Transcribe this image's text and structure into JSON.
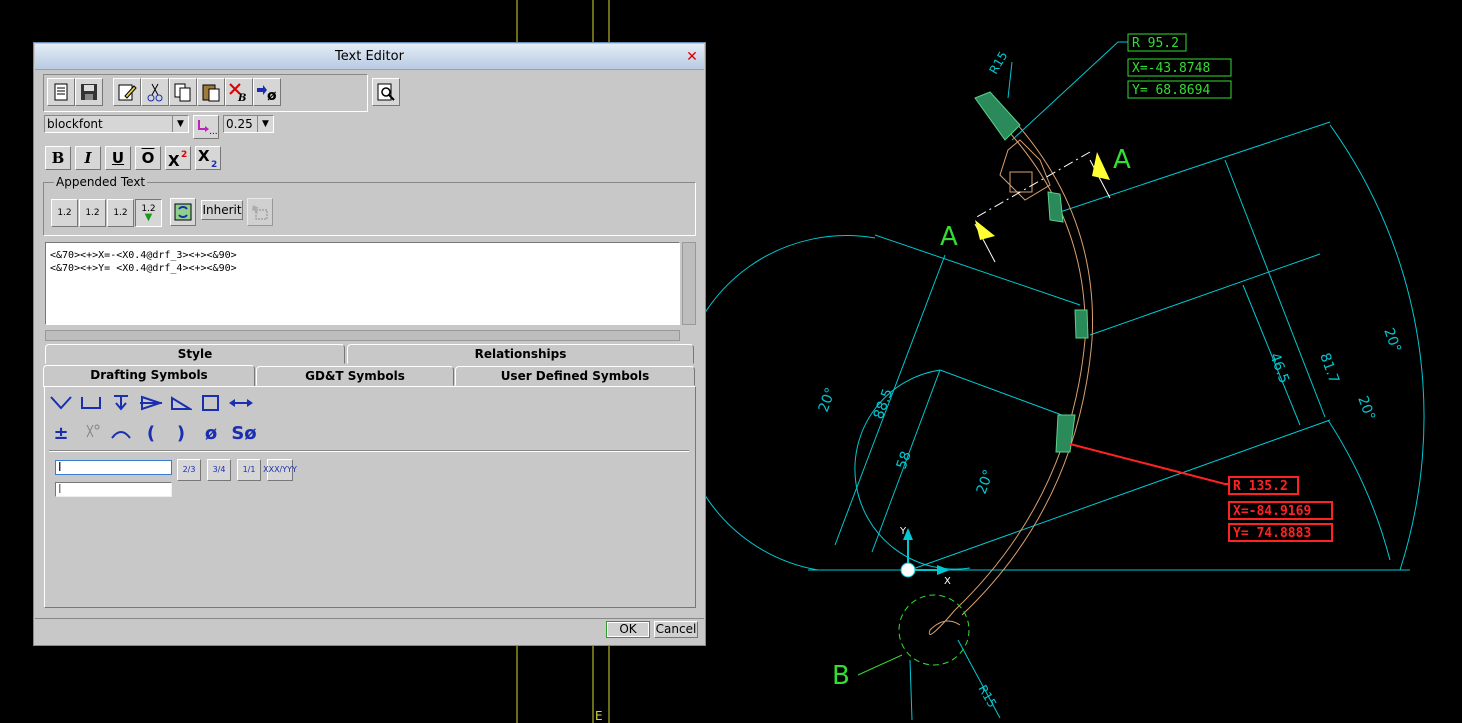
{
  "dialog": {
    "title": "Text Editor",
    "close_glyph": "✕",
    "font_name": "blockfont",
    "font_size": "0.25",
    "appended_text_label": "Appended Text",
    "inherit_label": "Inherit",
    "text_lines": [
      "<&70><+>X=-<X0.4@drf_3><+><&90>",
      "<&70><+>Y= <X0.4@drf_4><+><&90>"
    ],
    "tabs_top": [
      "Style",
      "Relationships"
    ],
    "tabs_bottom": [
      "Drafting Symbols",
      "GD&T Symbols",
      "User Defined Symbols"
    ],
    "symbols_row2_text": [
      "±",
      "(",
      ")",
      "ø",
      "Sø"
    ],
    "ok_label": "OK",
    "cancel_label": "Cancel",
    "format_buttons": {
      "bold": "B",
      "italic": "I",
      "underline": "U",
      "overline": "O"
    },
    "append_buttons": [
      "1.2",
      "1.2",
      "1.2",
      "1.2"
    ],
    "fraction_buttons": [
      "2/3",
      "3/4",
      "1/1",
      "XXX/YYY"
    ],
    "icons": [
      "new-file-icon",
      "save-icon",
      "edit-icon",
      "cut-icon",
      "copy-icon",
      "paste-icon",
      "clear-format-icon",
      "insert-symbol-icon",
      "preview-icon",
      "color-insert-icon",
      "refresh-icon",
      "select-object-icon"
    ]
  },
  "cad": {
    "labels": {
      "r_green": "R 95.2",
      "x_green": "X=-43.8748",
      "y_green": "Y= 68.8694",
      "r_red": "R 135.2",
      "x_red": "X=-84.9169",
      "y_red": "Y= 74.8883",
      "section_a": "A",
      "detail_b": "B",
      "r15_top": "R15",
      "r15_bottom": "R15",
      "dim_817": "81.7",
      "dim_465": "46.5",
      "dim_885": "88.5",
      "dim_58": "58",
      "ang_20_a": "20°",
      "ang_20_b": "20°",
      "ang_20_c": "20°",
      "ang_20_d": "20°",
      "axis_x": "X",
      "axis_y": "Y",
      "border_e": "E"
    },
    "colors": {
      "dim": "#00c8d2",
      "green": "#33dd33",
      "red": "#ff2222",
      "part": "#d9a070",
      "yellow": "#ffff33"
    }
  }
}
